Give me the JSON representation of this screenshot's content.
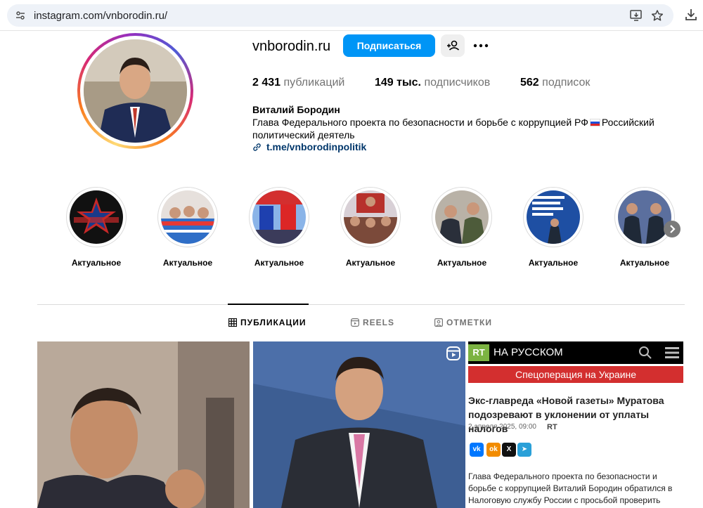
{
  "browser": {
    "url_host": "instagram.com/",
    "url_path": "vnborodin.ru/"
  },
  "profile": {
    "username": "vnborodin.ru",
    "follow_label": "Подписаться",
    "posts_count": "2 431",
    "posts_label": "публикаций",
    "followers_count": "149 тыс.",
    "followers_label": "подписчиков",
    "following_count": "562",
    "following_label": "подписок",
    "full_name": "Виталий Бородин",
    "bio_part1": "Глава Федерального проекта по безопасности и борьбе с коррупцией РФ",
    "bio_part2": "Российский политический деятель",
    "link": "t.me/vnborodinpolitik"
  },
  "highlights": [
    {
      "label": "Актуальное"
    },
    {
      "label": "Актуальное"
    },
    {
      "label": "Актуальное"
    },
    {
      "label": "Актуальное"
    },
    {
      "label": "Актуальное"
    },
    {
      "label": "Актуальное"
    },
    {
      "label": "Актуальное"
    }
  ],
  "tabs": {
    "posts": "ПУБЛИКАЦИИ",
    "reels": "REELS",
    "tagged": "ОТМЕТКИ"
  },
  "rt_post": {
    "logo": "RT",
    "header": "НА РУССКОМ",
    "banner": "Спецоперация на Украине",
    "headline": "Экс-главреда «Новой газеты» Муратова подозревают в уклонении от уплаты налогов",
    "date": "2 апреля 2025, 09:00",
    "source": "RT",
    "body": "Глава Федерального проекта по безопасности и борьбе с коррупцией Виталий Бородин обратился в Налоговую службу России с просьбой проверить"
  },
  "colors": {
    "follow_button": "#0095f6",
    "link": "#00376b",
    "rt_banner": "#d32f2f"
  }
}
